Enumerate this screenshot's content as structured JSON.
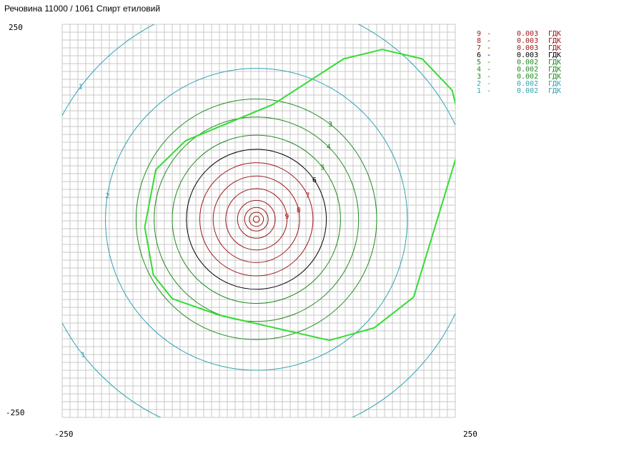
{
  "title": "Речовина 11000 / 1061 Спирт етиловий",
  "chart_data": {
    "type": "contour",
    "title": "Речовина 11000 / 1061 Спирт етиловий",
    "xlim": [
      -250,
      250
    ],
    "ylim": [
      -250,
      250
    ],
    "tick_labels": {
      "x_min": "-250",
      "x_max": "250",
      "y_min": "-250",
      "y_max": "250"
    },
    "grid": true,
    "grid_step": 10,
    "source_center": [
      -3,
      2
    ],
    "levels": [
      {
        "level": "1",
        "value": "0.002",
        "unit": "ГДК",
        "color": "#2fa3b3",
        "radius": 280
      },
      {
        "level": "2",
        "value": "0.002",
        "unit": "ГДК",
        "color": "#2fa3b3",
        "radius": 192
      },
      {
        "level": "3",
        "value": "0.002",
        "unit": "ГДК",
        "color": "#1f8a1f",
        "radius": 153
      },
      {
        "level": "4",
        "value": "0.002",
        "unit": "ГДК",
        "color": "#1f8a1f",
        "radius": 130
      },
      {
        "level": "5",
        "value": "0.002",
        "unit": "ГДК",
        "color": "#1f8a1f",
        "radius": 107
      },
      {
        "level": "6",
        "value": "0.003",
        "unit": "ГДК",
        "color": "#000000",
        "radius": 89
      },
      {
        "level": "7",
        "value": "0.003",
        "unit": "ГДК",
        "color": "#a01818",
        "radius": 72
      },
      {
        "level": "8",
        "value": "0.003",
        "unit": "ГДК",
        "color": "#a01818",
        "radius": 55
      },
      {
        "level": "9",
        "value": "0.003",
        "unit": "ГДК",
        "color": "#a01818",
        "radius": 39
      }
    ],
    "inner_rings": [
      24,
      15,
      9,
      4
    ],
    "boundary": {
      "color": "#33dd33",
      "points": [
        [
          -145,
          -8
        ],
        [
          -131,
          65
        ],
        [
          -93,
          102
        ],
        [
          18,
          148
        ],
        [
          108,
          206
        ],
        [
          157,
          218
        ],
        [
          208,
          206
        ],
        [
          246,
          166
        ],
        [
          260,
          110
        ],
        [
          197,
          -97
        ],
        [
          147,
          -136
        ],
        [
          90,
          -152
        ],
        [
          -50,
          -120
        ],
        [
          -110,
          -99
        ],
        [
          -134,
          -69
        ],
        [
          -145,
          -8
        ]
      ]
    }
  },
  "legend": [
    {
      "level": "9",
      "dash": "-",
      "value": "0.003",
      "unit": "ГДК",
      "color": "#a01818"
    },
    {
      "level": "8",
      "dash": "-",
      "value": "0.003",
      "unit": "ГДК",
      "color": "#a01818"
    },
    {
      "level": "7",
      "dash": "-",
      "value": "0.003",
      "unit": "ГДК",
      "color": "#a01818"
    },
    {
      "level": "6",
      "dash": "-",
      "value": "0.003",
      "unit": "ГДК",
      "color": "#000000"
    },
    {
      "level": "5",
      "dash": "-",
      "value": "0.002",
      "unit": "ГДК",
      "color": "#1f8a1f"
    },
    {
      "level": "4",
      "dash": "-",
      "value": "0.002",
      "unit": "ГДК",
      "color": "#1f8a1f"
    },
    {
      "level": "3",
      "dash": "-",
      "value": "0.002",
      "unit": "ГДК",
      "color": "#1f8a1f"
    },
    {
      "level": "2",
      "dash": "-",
      "value": "0.002",
      "unit": "ГДК",
      "color": "#2fa3b3"
    },
    {
      "level": "1",
      "dash": "-",
      "value": "0.002",
      "unit": "ГДК",
      "color": "#2fa3b3"
    }
  ],
  "colors": {
    "grid": "#c8c8c8",
    "boundary": "#33dd33"
  }
}
